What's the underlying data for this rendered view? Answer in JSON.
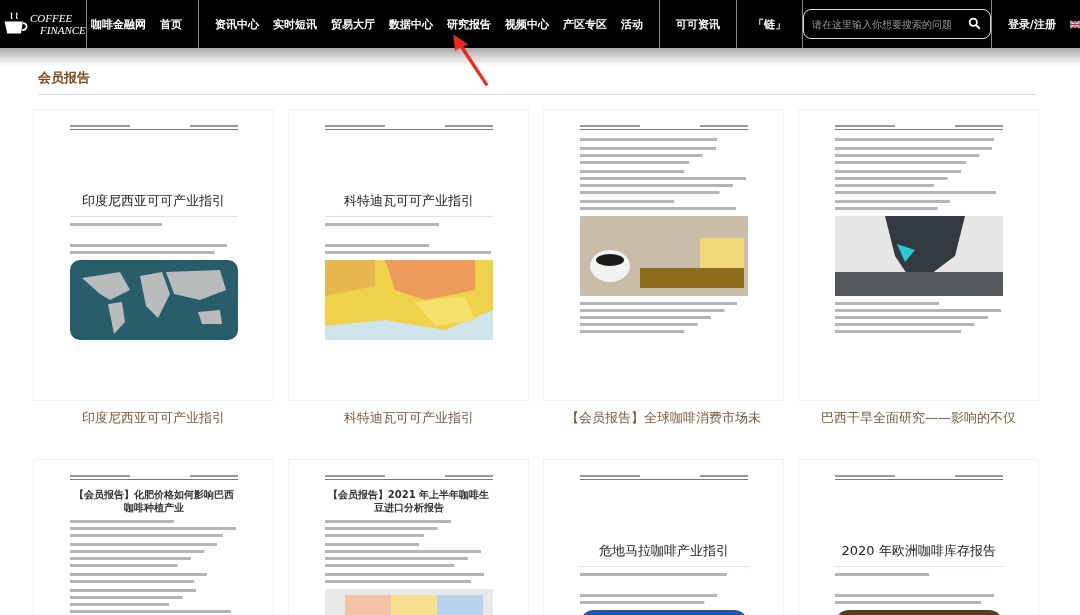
{
  "nav": {
    "logo": [
      "COFFEE",
      "FINANCE"
    ],
    "groups": [
      [
        "咖啡金融网",
        "首页"
      ],
      [
        "资讯中心",
        "实时短讯",
        "贸易大厅",
        "数据中心",
        "研究报告",
        "视频中心",
        "产区专区",
        "活动"
      ],
      [
        "可可资讯"
      ],
      [
        "「链」"
      ]
    ],
    "search": {
      "placeholder": "请在这里输入你想要搜索的问题"
    },
    "login": "登录/注册"
  },
  "section": {
    "title": "会员报告"
  },
  "cards": [
    {
      "kind": "cover",
      "doc_title": "印度尼西亚可可产业指引",
      "figure": true,
      "caption": "印度尼西亚可可产业指引"
    },
    {
      "kind": "cover",
      "doc_title": "科特迪瓦可可产业指引",
      "figure": true,
      "caption": "科特迪瓦可可产业指引"
    },
    {
      "kind": "article",
      "figure": true,
      "caption": "【会员报告】全球咖啡消费市场未"
    },
    {
      "kind": "article",
      "figure": true,
      "caption": "巴西干旱全面研究——影响的不仅"
    },
    {
      "kind": "article",
      "doc_title": "【会员报告】化肥价格如何影响巴西咖啡种植产业",
      "figure": false
    },
    {
      "kind": "article",
      "doc_title": "【会员报告】2021 年上半年咖啡生豆进口分析报告",
      "figure": true
    },
    {
      "kind": "cover",
      "doc_title": "危地马拉咖啡产业指引",
      "figure": true
    },
    {
      "kind": "cover",
      "doc_title": "2020 年欧洲咖啡库存报告",
      "figure": true
    }
  ],
  "annotation": {
    "kind": "arrow"
  }
}
